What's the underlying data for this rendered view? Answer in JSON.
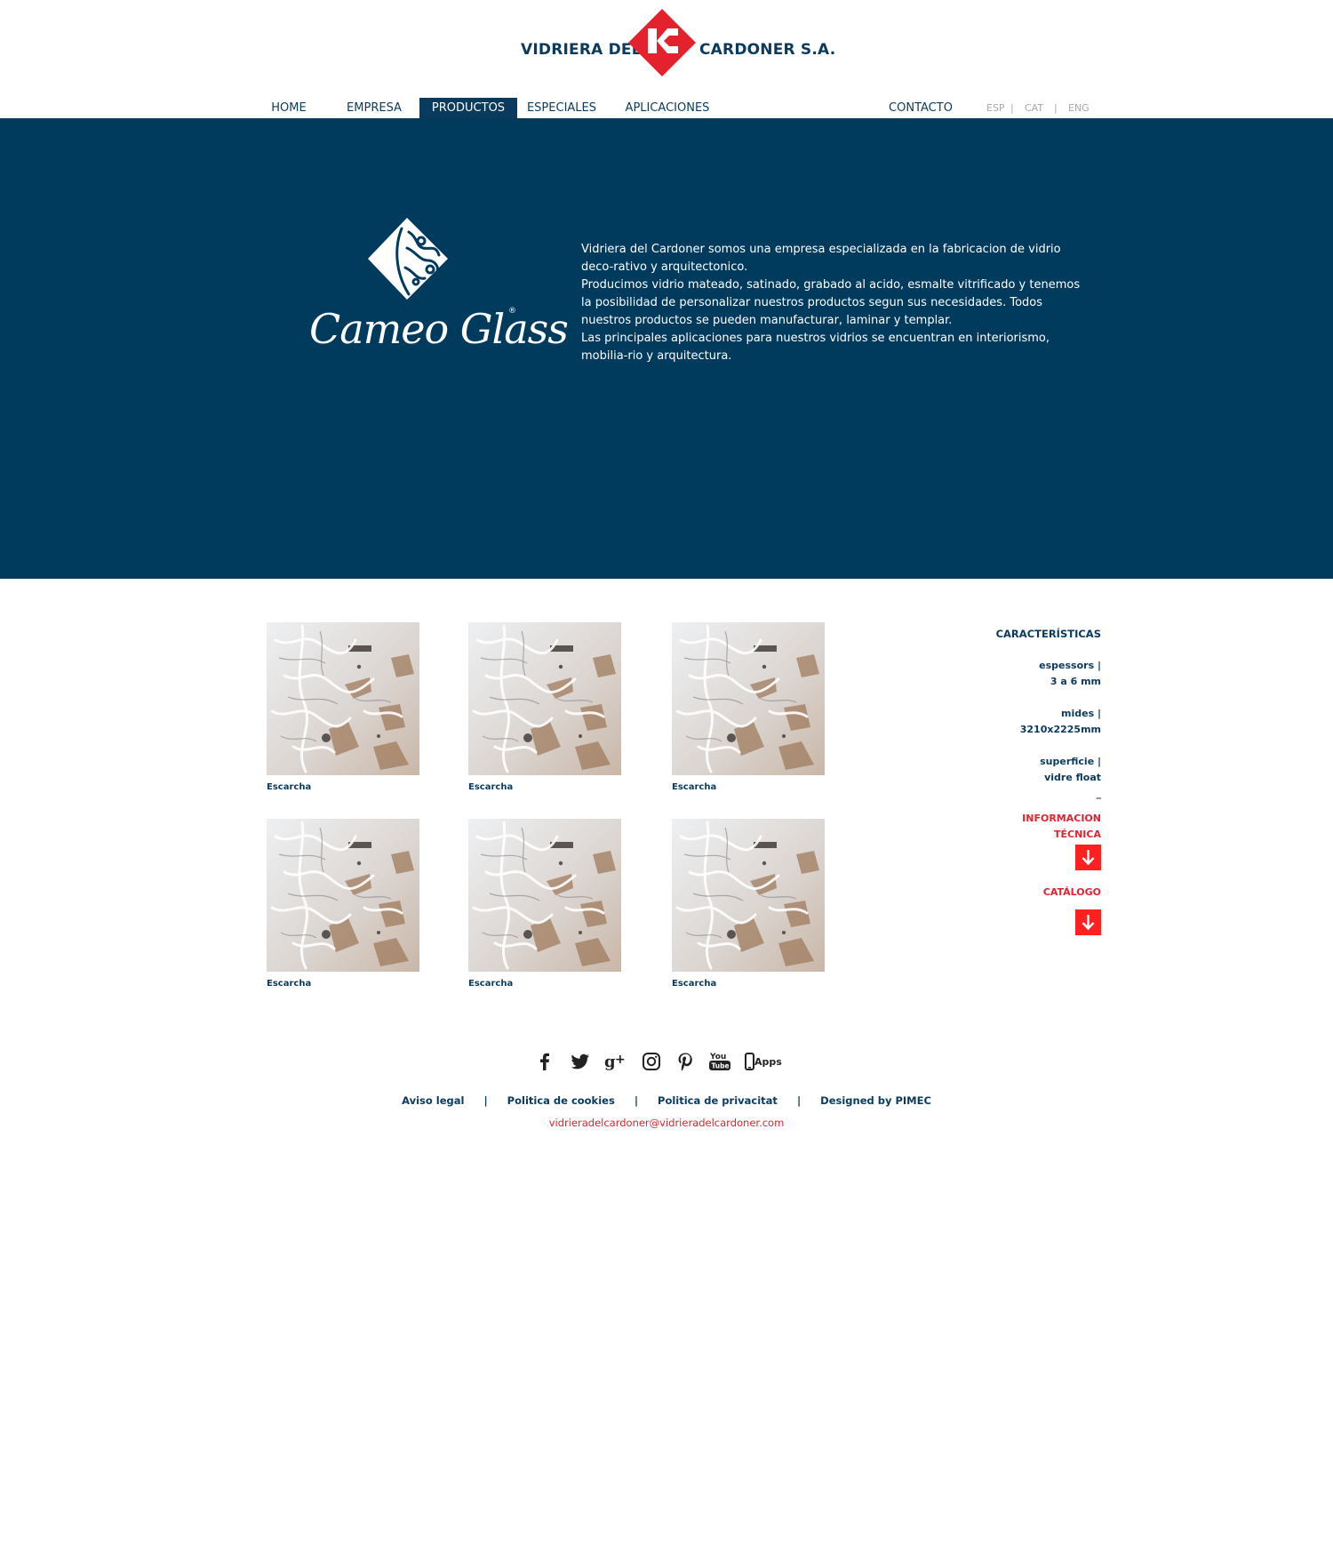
{
  "brand": {
    "left": "VIDRIERA DEL",
    "right": "CARDONER S.A.",
    "registered": "®",
    "colors": {
      "navy": "#0a3a5e",
      "hero": "#003b5e",
      "red": "#e3222d"
    }
  },
  "nav": {
    "items": [
      {
        "label": "HOME"
      },
      {
        "label": "EMPRESA"
      },
      {
        "label": "PRODUCTOS",
        "active": true
      },
      {
        "label": "ESPECIALES"
      },
      {
        "label": "APLICACIONES"
      }
    ],
    "contact": "CONTACTO",
    "languages": [
      "ESP",
      "CAT",
      "ENG"
    ],
    "sep": "|"
  },
  "hero": {
    "product_logo": "Cameo Glass",
    "registered": "®",
    "paragraphs": [
      "Vidriera del Cardoner somos una empresa especializada en la fabricacion de vidrio deco-rativo y arquitectonico.",
      "Producimos vidrio mateado, satinado, grabado al acido, esmalte vitrificado y tenemos la posibilidad de personalizar nuestros productos segun sus necesidades. Todos nuestros productos se pueden manufacturar, laminar y templar.",
      "Las principales aplicaciones para nuestros vidrios se encuentran en interiorismo, mobilia-rio y arquitectura."
    ]
  },
  "products": [
    {
      "caption": "Escarcha"
    },
    {
      "caption": "Escarcha"
    },
    {
      "caption": "Escarcha"
    },
    {
      "caption": "Escarcha"
    },
    {
      "caption": "Escarcha"
    },
    {
      "caption": "Escarcha"
    }
  ],
  "characteristics": {
    "title": "CARACTERÍSTICAS",
    "espessors_label": "espessors |",
    "espessors_value": "3 a 6 mm",
    "mides_label": "mides |",
    "mides_value": "3210x2225mm",
    "superficie_label": "superficie |",
    "superficie_value": "vidre float",
    "dash": "_",
    "info_line1": "INFORMACION",
    "info_line2": "TÉCNICA",
    "catalog": "CATÁLOGO",
    "download_icon": "arrow-down-icon"
  },
  "footer": {
    "social": [
      "facebook-icon",
      "twitter-icon",
      "google-plus-icon",
      "instagram-icon",
      "pinterest-icon",
      "youtube-icon",
      "apps-icon"
    ],
    "youtube_text_top": "You",
    "youtube_text_bottom": "Tube",
    "apps_label": "Apps",
    "links": [
      "Aviso legal",
      "Politica de cookies",
      "Politica de privacitat",
      "Designed by PIMEC"
    ],
    "sep": "|",
    "email": "vidrieradelcardoner@vidrieradelcardoner.com"
  }
}
